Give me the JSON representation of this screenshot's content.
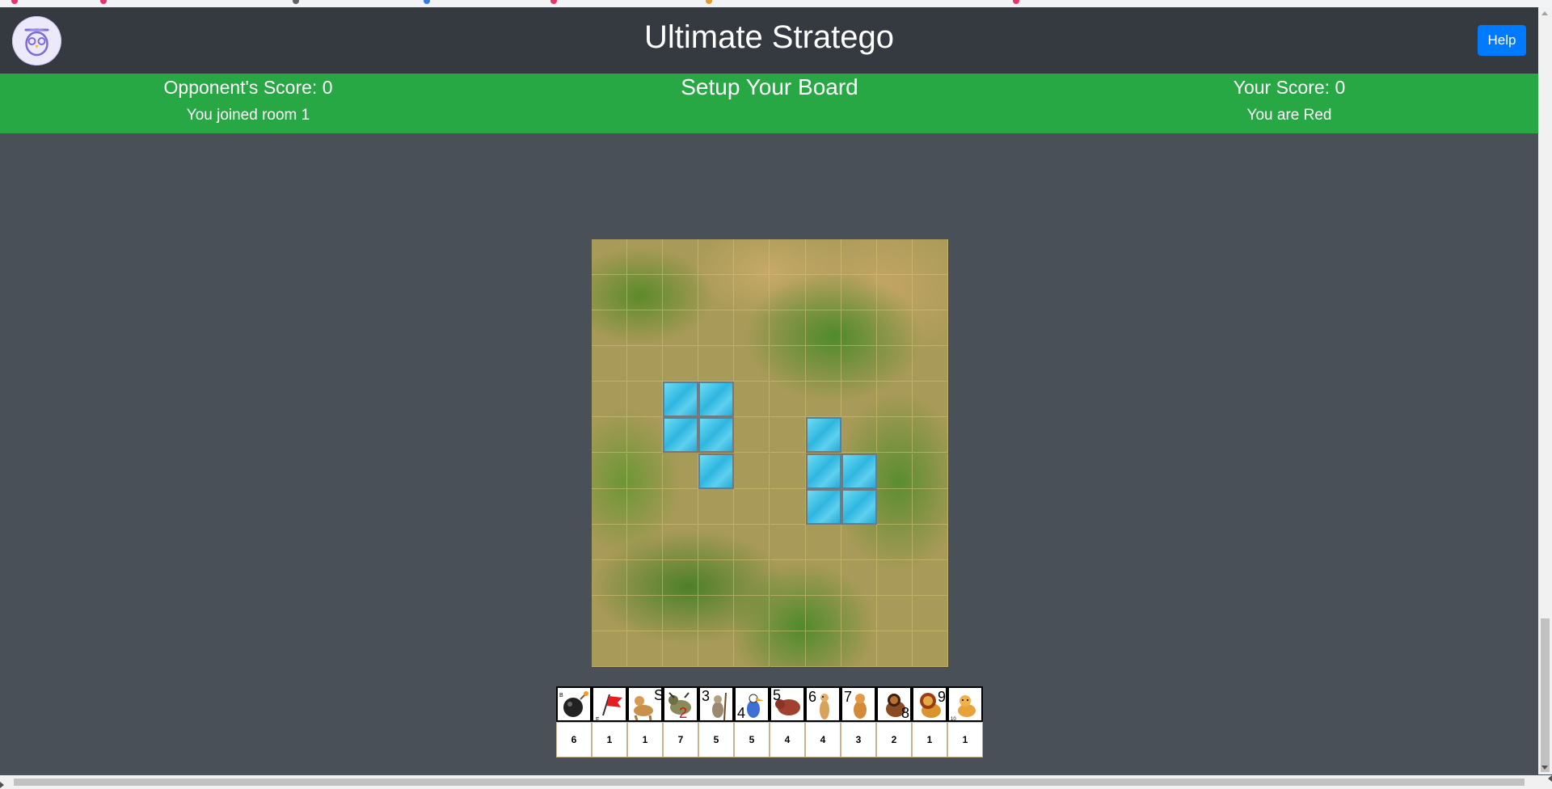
{
  "app": {
    "title": "Ultimate Stratego",
    "help_label": "Help"
  },
  "status": {
    "opponent_score": "Opponent's Score: 0",
    "room_message": "You joined room 1",
    "phase": "Setup Your Board",
    "your_score": "Your Score: 0",
    "color_message": "You are Red"
  },
  "board": {
    "columns": 10,
    "rows": 12,
    "terrain": "grass"
  },
  "pieces": [
    {
      "id": "bomb",
      "rank": "B",
      "icon": "bomb-icon",
      "count": "6"
    },
    {
      "id": "flag",
      "rank": "F",
      "icon": "red-flag-icon",
      "count": "1"
    },
    {
      "id": "spy",
      "rank": "S",
      "icon": "lioness-icon",
      "count": "1"
    },
    {
      "id": "scout",
      "rank": "2",
      "icon": "hyena-icon",
      "count": "7"
    },
    {
      "id": "miner",
      "rank": "3",
      "icon": "baboon-icon",
      "count": "5"
    },
    {
      "id": "sergeant",
      "rank": "4",
      "icon": "hornbill-icon",
      "count": "5"
    },
    {
      "id": "lieutenant",
      "rank": "5",
      "icon": "warthog-icon",
      "count": "4"
    },
    {
      "id": "captain",
      "rank": "6",
      "icon": "meerkat-icon",
      "count": "4"
    },
    {
      "id": "major",
      "rank": "7",
      "icon": "young-lion-icon",
      "count": "3"
    },
    {
      "id": "colonel",
      "rank": "8",
      "icon": "dark-lion-icon",
      "count": "2"
    },
    {
      "id": "general",
      "rank": "9",
      "icon": "lion-king-icon",
      "count": "1"
    },
    {
      "id": "marshal",
      "rank": "10",
      "icon": "lion-cub-icon",
      "count": "1"
    }
  ],
  "colors": {
    "navbar": "#343a40",
    "status_bar": "#28a745",
    "background": "#495057",
    "help_button": "#007bff"
  }
}
